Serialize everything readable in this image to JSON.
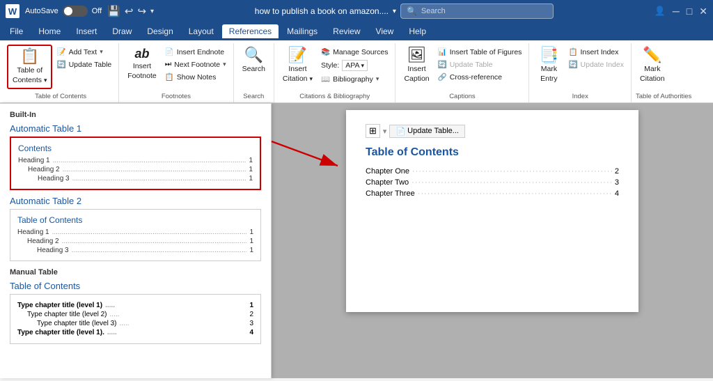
{
  "titleBar": {
    "logo": "W",
    "autoSave": "AutoSave",
    "toggleState": "Off",
    "docTitle": "how to publish a book on amazon....",
    "searchPlaceholder": "Search"
  },
  "menuBar": {
    "items": [
      "File",
      "Home",
      "Insert",
      "Draw",
      "Design",
      "Layout",
      "References",
      "Mailings",
      "Review",
      "View",
      "Help"
    ],
    "activeItem": "References"
  },
  "ribbon": {
    "groups": [
      {
        "label": "Table of Contents",
        "mainBtn": {
          "icon": "📋",
          "label": "Table of\nContents",
          "dropdown": true
        },
        "subBtns": [
          {
            "label": "Add Text",
            "dropdown": true
          },
          {
            "label": "Update Table"
          }
        ]
      },
      {
        "label": "Footnotes",
        "mainBtn": {
          "icon": "ab",
          "label": "Insert\nFootnote"
        },
        "subBtns": [
          {
            "label": "Insert Endnote"
          },
          {
            "label": "Next Footnote",
            "dropdown": true
          },
          {
            "label": "Show Notes"
          }
        ]
      },
      {
        "label": "Search",
        "mainBtn": {
          "icon": "🔍",
          "label": "Search"
        }
      },
      {
        "label": "Citations & Bibliography",
        "mainBtn": {
          "icon": "📝",
          "label": "Insert\nCitation",
          "dropdown": true
        },
        "subBtns": [
          {
            "label": "Manage Sources"
          },
          {
            "label": "Style:",
            "combo": "APA"
          },
          {
            "label": "Bibliography",
            "dropdown": true
          }
        ]
      },
      {
        "label": "Captions",
        "mainBtn": {
          "icon": "🖼",
          "label": "Insert\nCaption"
        },
        "subBtns": [
          {
            "label": "Insert Table of Figures"
          },
          {
            "label": "Update Table"
          },
          {
            "label": "Cross-reference"
          }
        ]
      },
      {
        "label": "Index",
        "mainBtn": {
          "icon": "📑",
          "label": "Mark\nEntry"
        },
        "subBtns": [
          {
            "label": "Insert Index"
          },
          {
            "label": "Update Index"
          }
        ]
      },
      {
        "label": "Table of Authorities",
        "mainBtn": {
          "icon": "✏️",
          "label": "Mark\nCitation"
        }
      }
    ]
  },
  "tocDropdown": {
    "sections": [
      {
        "label": "Built-In",
        "items": [
          {
            "title": "Automatic Table 1",
            "preview": {
              "heading": "Contents",
              "rows": [
                {
                  "text": "Heading 1",
                  "dots": true,
                  "num": "1",
                  "indent": 0
                },
                {
                  "text": "Heading 2",
                  "dots": true,
                  "num": "1",
                  "indent": 1
                },
                {
                  "text": "Heading 3",
                  "dots": true,
                  "num": "1",
                  "indent": 2
                }
              ]
            },
            "selected": true
          },
          {
            "title": "Automatic Table 2",
            "preview": {
              "heading": "Table of Contents",
              "rows": [
                {
                  "text": "Heading 1",
                  "dots": true,
                  "num": "1",
                  "indent": 0
                },
                {
                  "text": "Heading 2",
                  "dots": true,
                  "num": "1",
                  "indent": 1
                },
                {
                  "text": "Heading 3",
                  "dots": true,
                  "num": "1",
                  "indent": 2
                }
              ]
            },
            "selected": false
          }
        ]
      },
      {
        "label": "Manual Table",
        "items": [
          {
            "title": "Table of Contents",
            "manualRows": [
              {
                "text": "Type chapter title (level 1)",
                "num": "1",
                "indent": 0,
                "bold": true
              },
              {
                "text": "Type chapter title (level 2)",
                "num": "2",
                "indent": 1,
                "bold": false
              },
              {
                "text": "Type chapter title (level 3)",
                "num": "3",
                "indent": 2,
                "bold": false
              },
              {
                "text": "Type chapter title (level 1).",
                "num": "4",
                "indent": 0,
                "bold": true
              }
            ]
          }
        ]
      }
    ]
  },
  "docToolbar": {
    "updateLabel": "Update Table..."
  },
  "docPage": {
    "title": "Table of Contents",
    "rows": [
      {
        "text": "Chapter One",
        "num": "2"
      },
      {
        "text": "Chapter Two",
        "num": "3"
      },
      {
        "text": "Chapter Three",
        "num": "4"
      }
    ]
  }
}
